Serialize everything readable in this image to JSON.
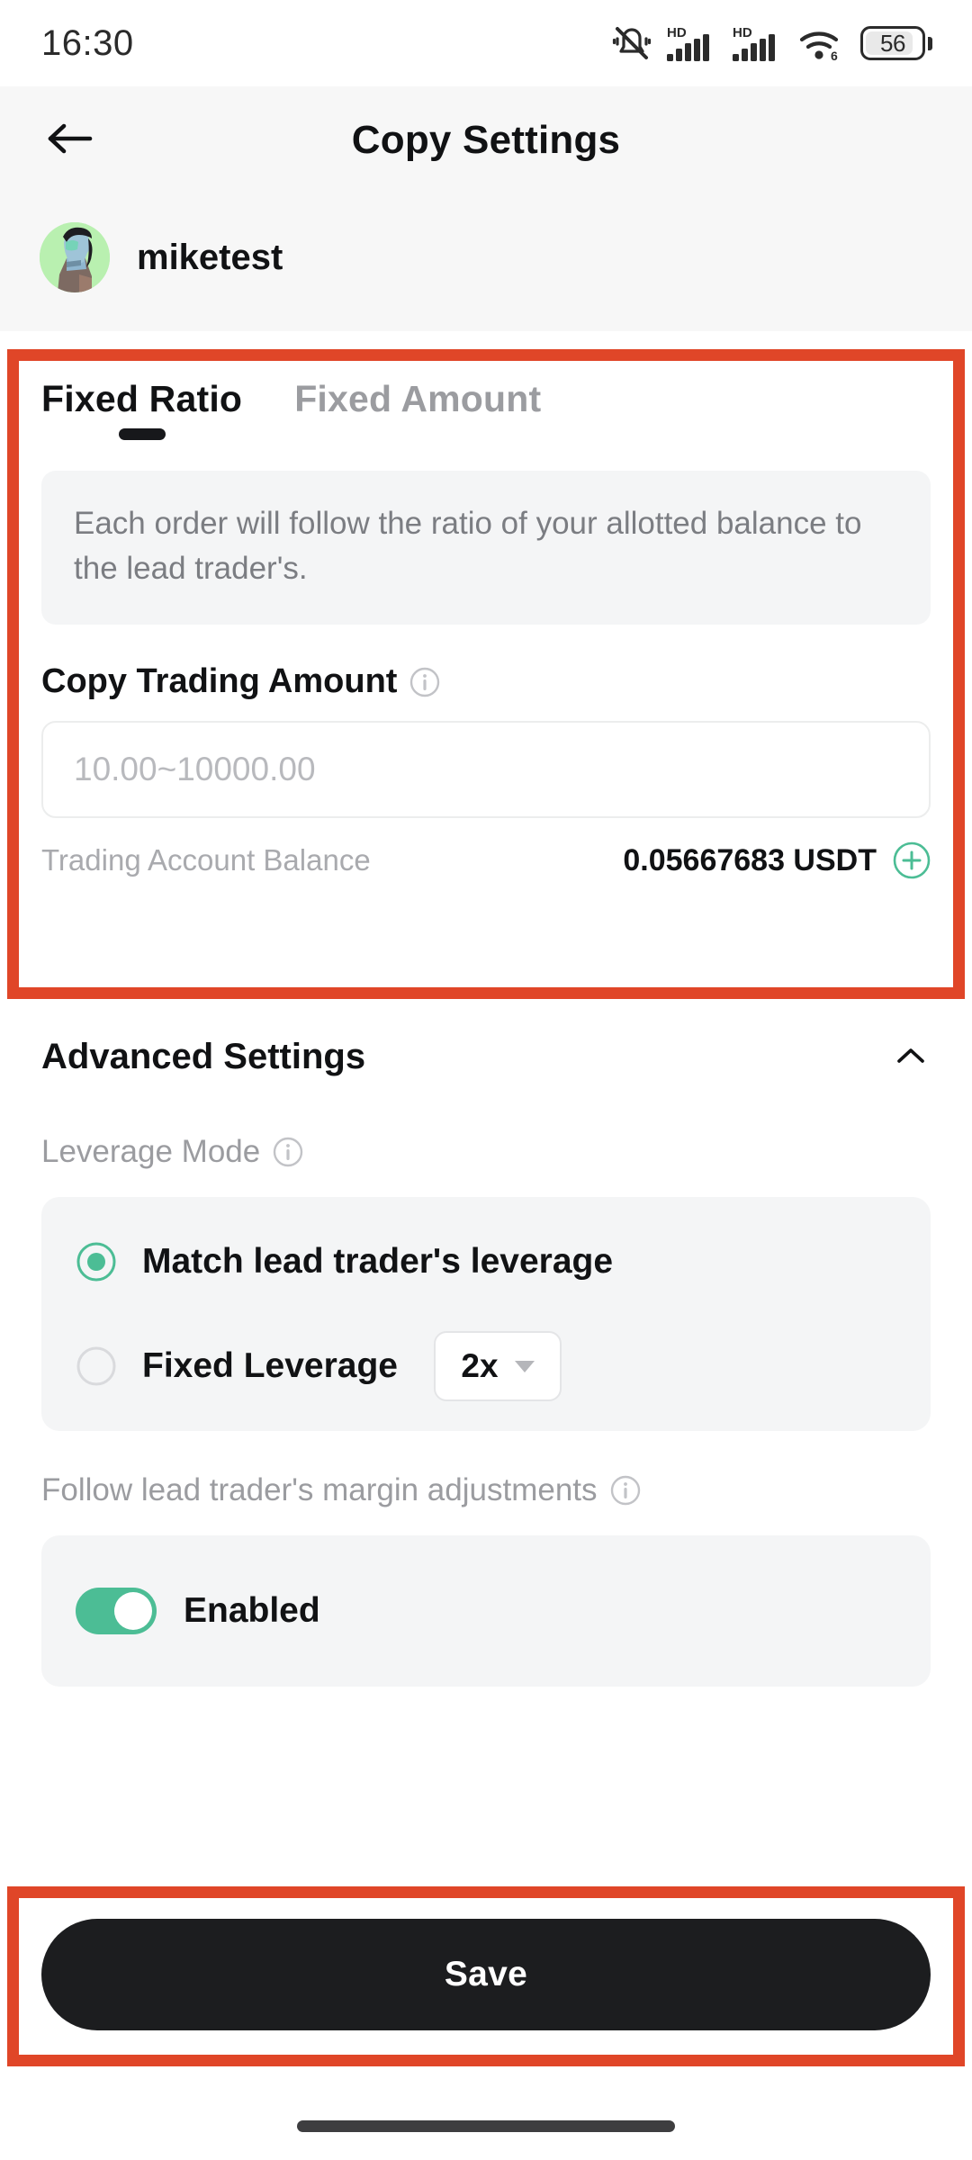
{
  "status_bar": {
    "time": "16:30",
    "battery_level": "56",
    "icons": [
      "silent-mode-icon",
      "hd-signal-icon",
      "hd-signal-icon-2",
      "wifi-6-icon",
      "battery-icon"
    ]
  },
  "header": {
    "back_icon": "back-arrow-icon",
    "title": "Copy Settings",
    "trader_name": "miketest",
    "avatar_icon": "user-avatar"
  },
  "tabs": [
    {
      "label": "Fixed Ratio",
      "active": true
    },
    {
      "label": "Fixed Amount",
      "active": false
    }
  ],
  "info_note": "Each order will follow the ratio of your allotted balance to the lead trader's.",
  "copy_trading_amount": {
    "label": "Copy Trading Amount",
    "info_icon": "info-icon",
    "input_placeholder": "10.00~10000.00",
    "input_value": ""
  },
  "balance": {
    "label": "Trading Account Balance",
    "value": "0.05667683 USDT",
    "add_icon": "plus-circle-icon"
  },
  "advanced_settings": {
    "title": "Advanced Settings",
    "expanded": true,
    "collapse_icon": "chevron-up-icon",
    "leverage_mode": {
      "label": "Leverage Mode",
      "info_icon": "info-icon",
      "options": [
        {
          "label": "Match lead trader's leverage",
          "selected": true
        },
        {
          "label": "Fixed Leverage",
          "selected": false
        }
      ],
      "leverage_value": "2x",
      "leverage_dropdown_icon": "chevron-down-icon"
    },
    "margin_adjustments": {
      "label": "Follow lead trader's margin adjustments",
      "info_icon": "info-icon",
      "toggle_label": "Enabled",
      "toggle_on": true
    }
  },
  "save_button": {
    "label": "Save"
  },
  "colors": {
    "accent_green": "#4cbd95",
    "annotation_red": "#e04628",
    "button_dark": "#1c1d1f",
    "muted_text": "#9b9ca0"
  }
}
